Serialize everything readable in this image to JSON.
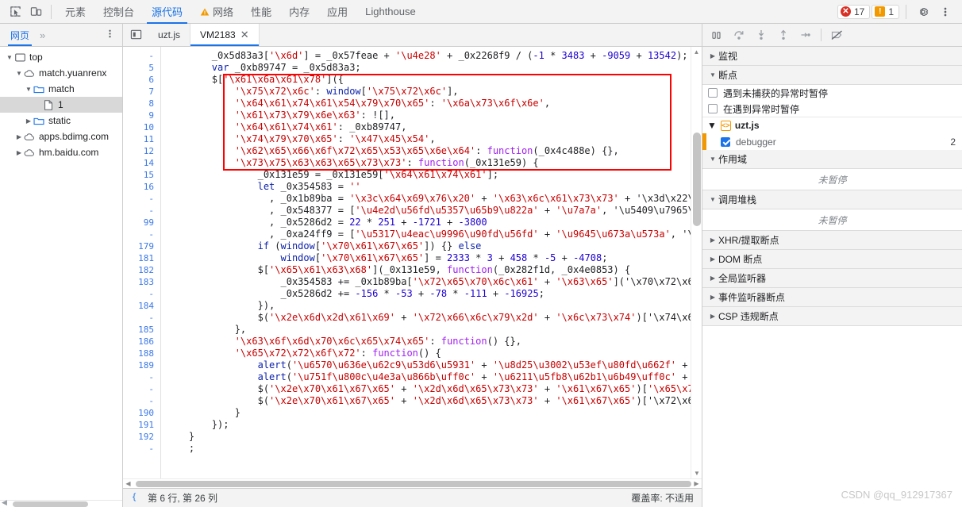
{
  "toolbar": {
    "inspect_icon": "inspect-element-icon",
    "device_icon": "device-toolbar-icon",
    "tabs": [
      {
        "label": "元素",
        "active": false,
        "warn": false
      },
      {
        "label": "控制台",
        "active": false,
        "warn": false
      },
      {
        "label": "源代码",
        "active": true,
        "warn": false
      },
      {
        "label": "网络",
        "active": false,
        "warn": true
      },
      {
        "label": "性能",
        "active": false,
        "warn": false
      },
      {
        "label": "内存",
        "active": false,
        "warn": false
      },
      {
        "label": "应用",
        "active": false,
        "warn": false
      },
      {
        "label": "Lighthouse",
        "active": false,
        "warn": false
      }
    ],
    "error_count": "17",
    "warning_count": "1",
    "settings_icon": "gear-icon",
    "more_icon": "more-vertical-icon"
  },
  "navbar": {
    "tab_label": "网页",
    "more_label": "»",
    "menu_icon": "more-vertical-icon",
    "sidebar_toggle_icon": "show-navigator-icon"
  },
  "editor_tabs": [
    {
      "label": "uzt.js",
      "active": false,
      "closable": false
    },
    {
      "label": "VM2183",
      "active": true,
      "closable": true,
      "close_label": "✕"
    }
  ],
  "debug_controls": [
    {
      "name": "pause-script-button",
      "icon": "pause-icon"
    },
    {
      "name": "step-over-button",
      "icon": "step-over-icon"
    },
    {
      "name": "step-into-button",
      "icon": "step-into-icon"
    },
    {
      "name": "step-out-button",
      "icon": "step-out-icon"
    },
    {
      "name": "step-button",
      "icon": "step-icon"
    },
    {
      "name": "deactivate-breakpoints-button",
      "icon": "deactivate-breakpoints-icon"
    }
  ],
  "file_tree": [
    {
      "label": "top",
      "depth": 0,
      "twisty": "▼",
      "icon": "frame-icon",
      "selected": false
    },
    {
      "label": "match.yuanrenx",
      "depth": 1,
      "twisty": "▼",
      "icon": "cloud-icon",
      "selected": false
    },
    {
      "label": "match",
      "depth": 2,
      "twisty": "▼",
      "icon": "folder-icon",
      "selected": false
    },
    {
      "label": "1",
      "depth": 3,
      "twisty": "",
      "icon": "file-icon",
      "selected": true
    },
    {
      "label": "static",
      "depth": 2,
      "twisty": "▶",
      "icon": "folder-icon",
      "selected": false
    },
    {
      "label": "apps.bdimg.com",
      "depth": 1,
      "twisty": "▶",
      "icon": "cloud-icon",
      "selected": false
    },
    {
      "label": "hm.baidu.com",
      "depth": 1,
      "twisty": "▶",
      "icon": "cloud-icon",
      "selected": false
    }
  ],
  "code": {
    "lines": [
      {
        "num": "-",
        "text": "        _0x5d83a3['\\x6d'] = _0x57feae + '\\u4e28' + _0x2268f9 / (-1 * 3483 + -9059 + 13542);"
      },
      {
        "num": "5",
        "text": "        var _0xb89747 = _0x5d83a3;"
      },
      {
        "num": "6",
        "text": "        $['\\x61\\x6a\\x61\\x78']({"
      },
      {
        "num": "7",
        "text": "            '\\x75\\x72\\x6c': window['\\x75\\x72\\x6c'],"
      },
      {
        "num": "8",
        "text": "            '\\x64\\x61\\x74\\x61\\x54\\x79\\x70\\x65': '\\x6a\\x73\\x6f\\x6e',"
      },
      {
        "num": "9",
        "text": "            '\\x61\\x73\\x79\\x6e\\x63': ![],"
      },
      {
        "num": "10",
        "text": "            '\\x64\\x61\\x74\\x61': _0xb89747,"
      },
      {
        "num": "11",
        "text": "            '\\x74\\x79\\x70\\x65': '\\x47\\x45\\x54',"
      },
      {
        "num": "12",
        "text": "            '\\x62\\x65\\x66\\x6f\\x72\\x65\\x53\\x65\\x6e\\x64': function(_0x4c488e) {},"
      },
      {
        "num": "14",
        "text": "            '\\x73\\x75\\x63\\x63\\x65\\x73\\x73': function(_0x131e59) {"
      },
      {
        "num": "15",
        "text": "                _0x131e59 = _0x131e59['\\x64\\x61\\x74\\x61'];"
      },
      {
        "num": "16",
        "text": "                let _0x354583 = ''"
      },
      {
        "num": "-",
        "text": "                  , _0x1b89ba = '\\x3c\\x64\\x69\\x76\\x20' + '\\x63\\x6c\\x61\\x73\\x73' + '\\x3d\\x22\\x6"
      },
      {
        "num": "-",
        "text": "                  , _0x548377 = ['\\u4e2d\\u56fd\\u5357\\u65b9\\u822a' + '\\u7a7a', '\\u5409\\u7965\\u8"
      },
      {
        "num": "99",
        "text": "                  , _0x5286d2 = 22 * 251 + -1721 + -3800"
      },
      {
        "num": "-",
        "text": "                  , _0xa24ff9 = ['\\u5317\\u4eac\\u9996\\u90fd\\u56fd' + '\\u9645\\u673a\\u573a', '\\u4"
      },
      {
        "num": "179",
        "text": "                if (window['\\x70\\x61\\x67\\x65']) {} else"
      },
      {
        "num": "181",
        "text": "                    window['\\x70\\x61\\x67\\x65'] = 2333 * 3 + 458 * -5 + -4708;"
      },
      {
        "num": "182",
        "text": "                $['\\x65\\x61\\x63\\x68'](_0x131e59, function(_0x282f1d, _0x4e0853) {"
      },
      {
        "num": "183",
        "text": "                    _0x354583 += _0x1b89ba['\\x72\\x65\\x70\\x6c\\x61' + '\\x63\\x65']('\\x70\\x72\\x69\\"
      },
      {
        "num": "-",
        "text": "                    _0x5286d2 += -156 * -53 + -78 * -111 + -16925;"
      },
      {
        "num": "184",
        "text": "                }),"
      },
      {
        "num": "-",
        "text": "                $('\\x2e\\x6d\\x2d\\x61\\x69' + '\\x72\\x66\\x6c\\x79\\x2d' + '\\x6c\\x73\\x74')['\\x74\\x65\\"
      },
      {
        "num": "185",
        "text": "            },"
      },
      {
        "num": "186",
        "text": "            '\\x63\\x6f\\x6d\\x70\\x6c\\x65\\x74\\x65': function() {},"
      },
      {
        "num": "188",
        "text": "            '\\x65\\x72\\x72\\x6f\\x72': function() {"
      },
      {
        "num": "189",
        "text": "                alert('\\u6570\\u636e\\u62c9\\u53d6\\u5931' + '\\u8d25\\u3002\\u53ef\\u80fd\\u662f' + '\\"
      },
      {
        "num": "-",
        "text": "                alert('\\u751f\\u800c\\u4e3a\\u866b\\uff0c' + '\\u6211\\u5fb8\\u62b1\\u6b49\\uff0c' + '\\"
      },
      {
        "num": "-",
        "text": "                $('\\x2e\\x70\\x61\\x67\\x65' + '\\x2d\\x6d\\x65\\x73\\x73' + '\\x61\\x67\\x65')['\\x65\\x71'"
      },
      {
        "num": "-",
        "text": "                $('\\x2e\\x70\\x61\\x67\\x65' + '\\x2d\\x6d\\x65\\x73\\x73' + '\\x61\\x67\\x65')['\\x72\\x65\\"
      },
      {
        "num": "190",
        "text": "            }"
      },
      {
        "num": "191",
        "text": "        });"
      },
      {
        "num": "192",
        "text": "    }"
      },
      {
        "num": "-",
        "text": "    ;"
      }
    ],
    "annotation_color": "#fe0000"
  },
  "status": {
    "format_icon": "pretty-print-icon",
    "cursor_position": "第 6 行, 第 26 列",
    "coverage": "覆盖率: 不适用"
  },
  "debug_side": {
    "watch": {
      "label": "监视",
      "twisty": "▶"
    },
    "breakpoints": {
      "label": "断点",
      "twisty": "▼",
      "options": [
        {
          "label": "遇到未捕获的异常时暂停",
          "checked": false
        },
        {
          "label": "在遇到异常时暂停",
          "checked": false
        }
      ],
      "file": {
        "name": "uzt.js",
        "twisty": "▼",
        "icon": "js-file-icon"
      },
      "items": [
        {
          "label": "debugger",
          "checked": true,
          "line": "2"
        }
      ]
    },
    "scope": {
      "label": "作用域",
      "twisty": "▼",
      "empty_text": "未暂停"
    },
    "call_stack": {
      "label": "调用堆栈",
      "twisty": "▼",
      "empty_text": "未暂停"
    },
    "collapsed_sections": [
      {
        "label": "XHR/提取断点",
        "twisty": "▶"
      },
      {
        "label": "DOM 断点",
        "twisty": "▶"
      },
      {
        "label": "全局监听器",
        "twisty": "▶"
      },
      {
        "label": "事件监听器断点",
        "twisty": "▶"
      },
      {
        "label": "CSP 违规断点",
        "twisty": "▶"
      }
    ]
  },
  "watermark": "CSDN @qq_912917367"
}
